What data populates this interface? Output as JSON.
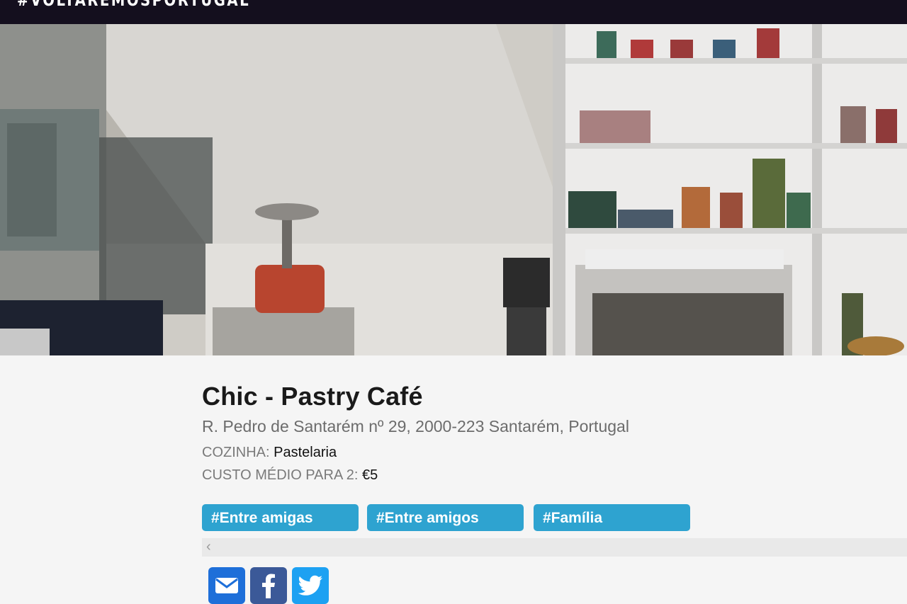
{
  "header": {
    "brand": "#VOLTAREMOSPORTUGAL"
  },
  "hero": {
    "alt": "Café interior photo"
  },
  "restaurant": {
    "name": "Chic - Pastry Café",
    "address": "R. Pedro de Santarém nº 29, 2000-223 Santarém, Portugal",
    "cuisine_label": "COZINHA: ",
    "cuisine_value": "Pastelaria",
    "cost_label": "CUSTO MÉDIO PARA 2: ",
    "cost_value": "€5"
  },
  "tags": [
    "#Entre amigas",
    "#Entre amigos",
    "#Família"
  ],
  "scroll": {
    "left_arrow": "‹"
  },
  "share": {
    "email_icon": "envelope-icon",
    "facebook_icon": "facebook-icon",
    "twitter_icon": "twitter-icon"
  },
  "colors": {
    "topbar": "#140f1e",
    "tag_bg": "#2ea3d0",
    "email": "#1e6fd9",
    "facebook": "#3b5998",
    "twitter": "#1da1f2"
  }
}
